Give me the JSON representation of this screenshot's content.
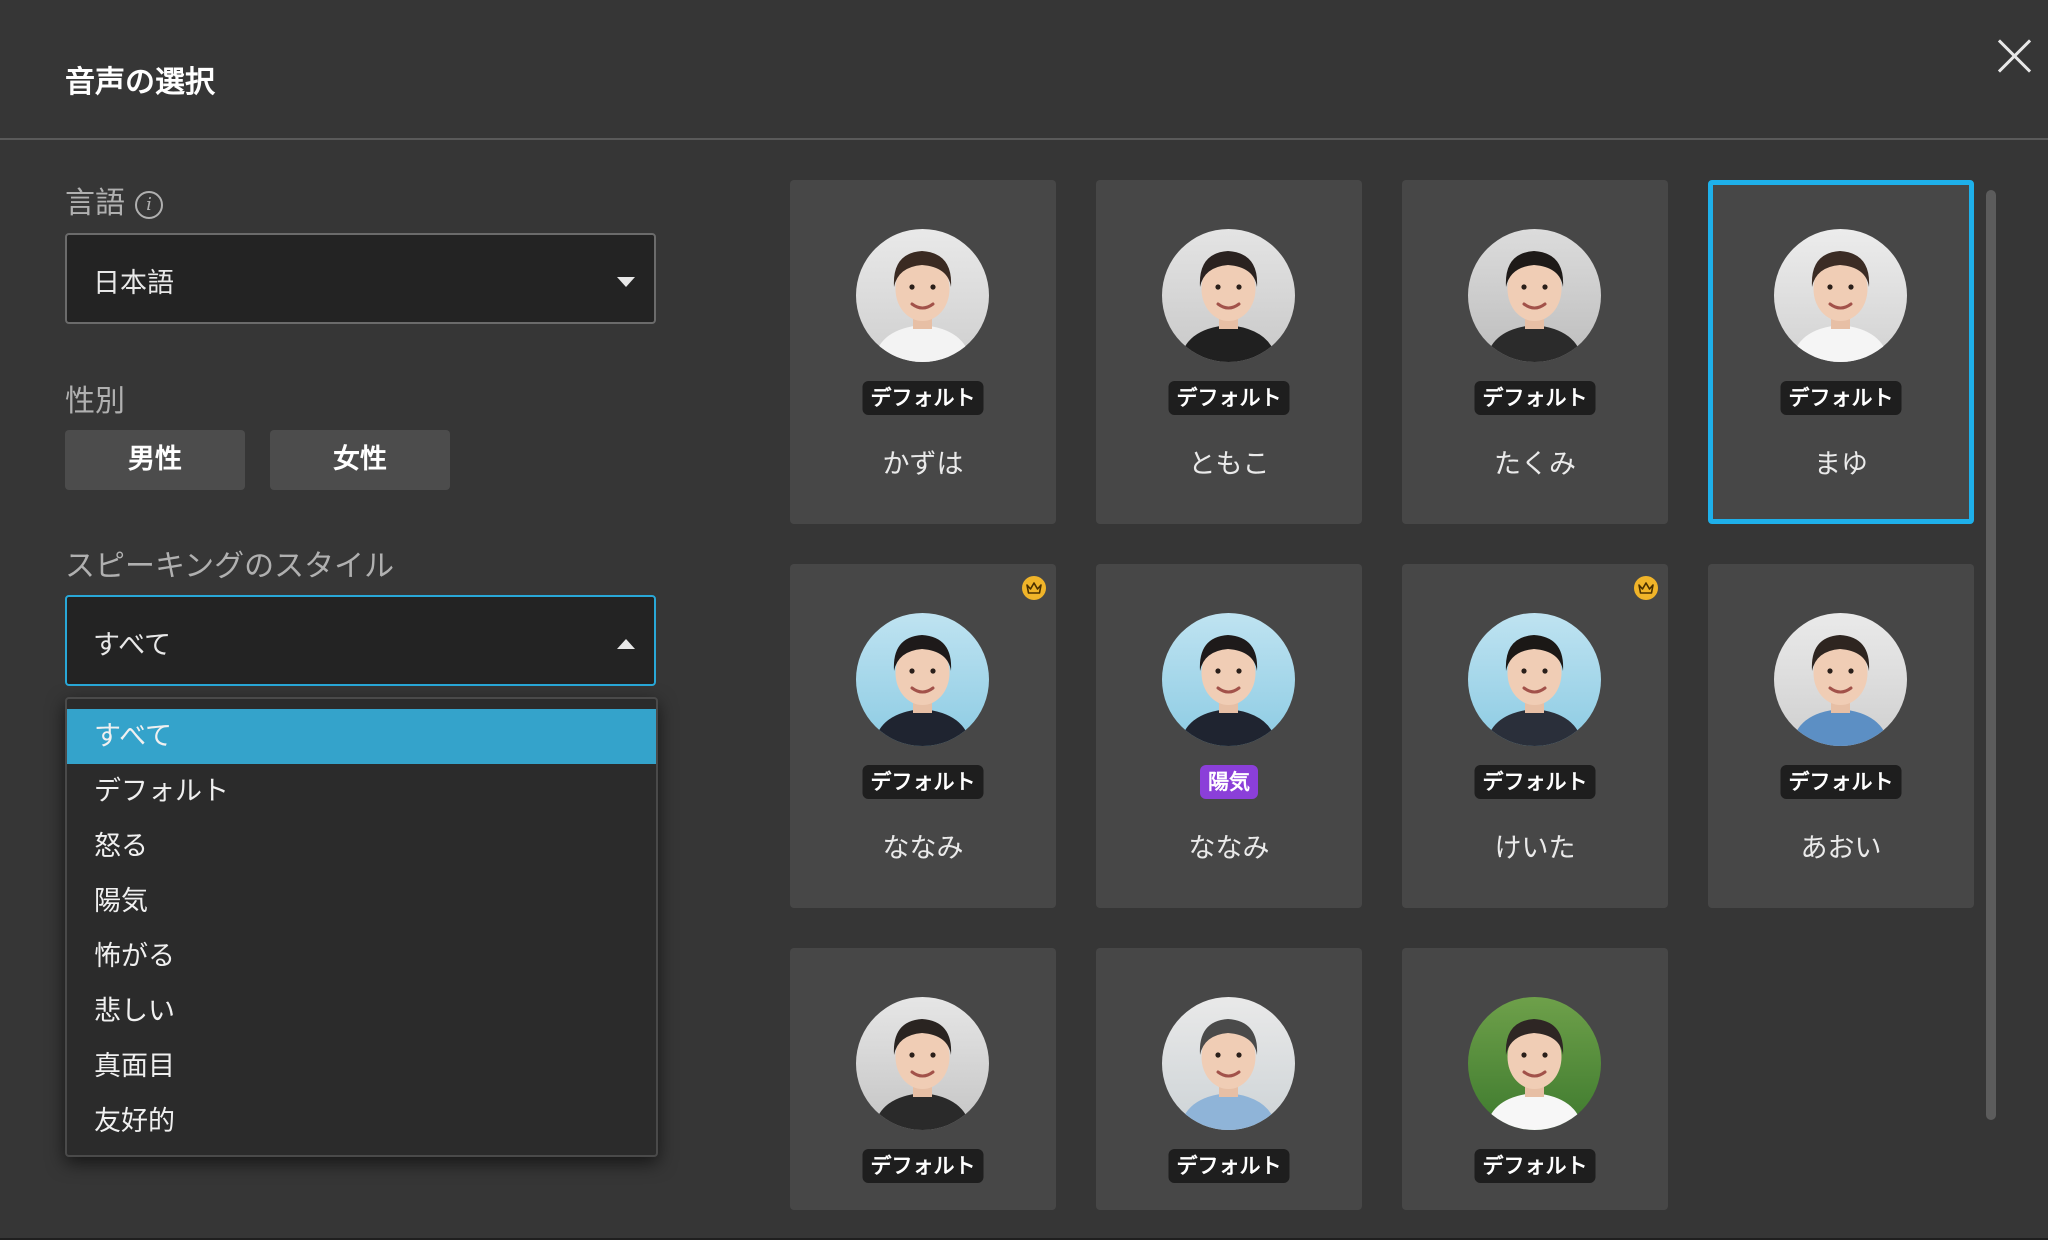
{
  "dialog": {
    "title": "音声の選択"
  },
  "language": {
    "label": "言語",
    "value": "日本語"
  },
  "gender": {
    "label": "性別",
    "male": "男性",
    "female": "女性"
  },
  "style": {
    "label": "スピーキングのスタイル",
    "value": "すべて"
  },
  "style_options": [
    "すべて",
    "デフォルト",
    "怒る",
    "陽気",
    "怖がる",
    "悲しい",
    "真面目",
    "友好的"
  ],
  "colors": {
    "accent": "#1eb0ea",
    "selected_option": "#34a3cb",
    "badge_default": "#1e1e1e",
    "badge_cheerful": "#8b3fd9",
    "premium_crown": "#f0b429"
  },
  "voices": [
    {
      "name": "かずは",
      "badge": "デフォルト",
      "premium": false,
      "selected": false,
      "avatar": "woman-avatar"
    },
    {
      "name": "ともこ",
      "badge": "デフォルト",
      "premium": false,
      "selected": false,
      "avatar": "woman-avatar"
    },
    {
      "name": "たくみ",
      "badge": "デフォルト",
      "premium": false,
      "selected": false,
      "avatar": "man-avatar"
    },
    {
      "name": "まゆ",
      "badge": "デフォルト",
      "premium": false,
      "selected": true,
      "avatar": "woman-avatar"
    },
    {
      "name": "ななみ",
      "badge": "デフォルト",
      "premium": true,
      "selected": false,
      "avatar": "woman-avatar"
    },
    {
      "name": "ななみ",
      "badge": "陽気",
      "premium": false,
      "selected": false,
      "avatar": "woman-avatar"
    },
    {
      "name": "けいた",
      "badge": "デフォルト",
      "premium": true,
      "selected": false,
      "avatar": "man-avatar"
    },
    {
      "name": "あおい",
      "badge": "デフォルト",
      "premium": false,
      "selected": false,
      "avatar": "girl-avatar"
    },
    {
      "name": "",
      "badge": "デフォルト",
      "premium": false,
      "selected": false,
      "avatar": "man-avatar"
    },
    {
      "name": "",
      "badge": "デフォルト",
      "premium": false,
      "selected": false,
      "avatar": "man-avatar"
    },
    {
      "name": "",
      "badge": "デフォルト",
      "premium": false,
      "selected": false,
      "avatar": "woman-avatar"
    }
  ]
}
